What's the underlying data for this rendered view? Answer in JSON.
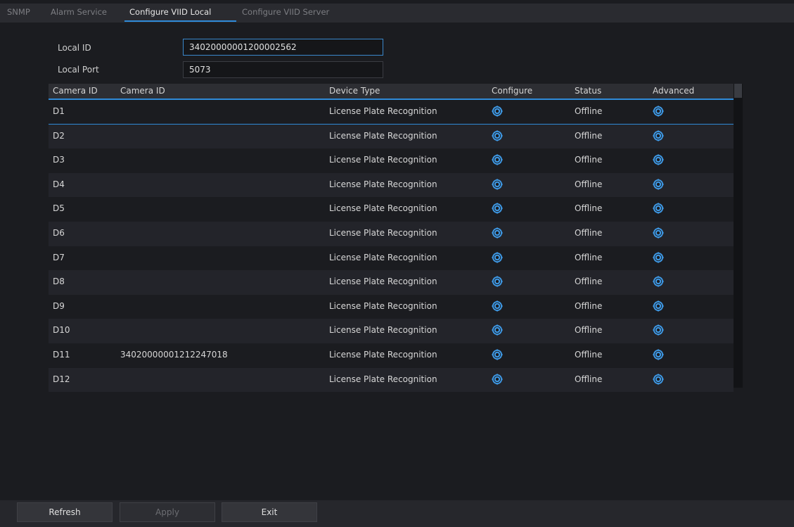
{
  "tabs": [
    {
      "label": "SNMP",
      "active": false
    },
    {
      "label": "Alarm Service",
      "active": false
    },
    {
      "label": "Configure VIID Local",
      "active": true
    },
    {
      "label": "Configure VIID Server",
      "active": false
    }
  ],
  "form": {
    "local_id_label": "Local ID",
    "local_id_value": "34020000001200002562",
    "local_port_label": "Local Port",
    "local_port_value": "5073"
  },
  "table": {
    "headers": [
      "Camera ID",
      "Camera ID",
      "Device Type",
      "Configure",
      "Status",
      "Advanced"
    ],
    "rows": [
      {
        "channel": "D1",
        "camera_id": "",
        "device_type": "License Plate Recognition",
        "status": "Offline"
      },
      {
        "channel": "D2",
        "camera_id": "",
        "device_type": "License Plate Recognition",
        "status": "Offline"
      },
      {
        "channel": "D3",
        "camera_id": "",
        "device_type": "License Plate Recognition",
        "status": "Offline"
      },
      {
        "channel": "D4",
        "camera_id": "",
        "device_type": "License Plate Recognition",
        "status": "Offline"
      },
      {
        "channel": "D5",
        "camera_id": "",
        "device_type": "License Plate Recognition",
        "status": "Offline"
      },
      {
        "channel": "D6",
        "camera_id": "",
        "device_type": "License Plate Recognition",
        "status": "Offline"
      },
      {
        "channel": "D7",
        "camera_id": "",
        "device_type": "License Plate Recognition",
        "status": "Offline"
      },
      {
        "channel": "D8",
        "camera_id": "",
        "device_type": "License Plate Recognition",
        "status": "Offline"
      },
      {
        "channel": "D9",
        "camera_id": "",
        "device_type": "License Plate Recognition",
        "status": "Offline"
      },
      {
        "channel": "D10",
        "camera_id": "",
        "device_type": "License Plate Recognition",
        "status": "Offline"
      },
      {
        "channel": "D11",
        "camera_id": "34020000001212247018",
        "device_type": "License Plate Recognition",
        "status": "Offline"
      },
      {
        "channel": "D12",
        "camera_id": "",
        "device_type": "License Plate Recognition",
        "status": "Offline"
      }
    ],
    "configure_icon": "gear-icon",
    "advanced_icon": "gear-icon"
  },
  "buttons": {
    "refresh": "Refresh",
    "apply": "Apply",
    "exit": "Exit"
  },
  "colors": {
    "accent": "#2f8ad8",
    "icon": "#3f9be8",
    "background": "#1b1c20"
  }
}
